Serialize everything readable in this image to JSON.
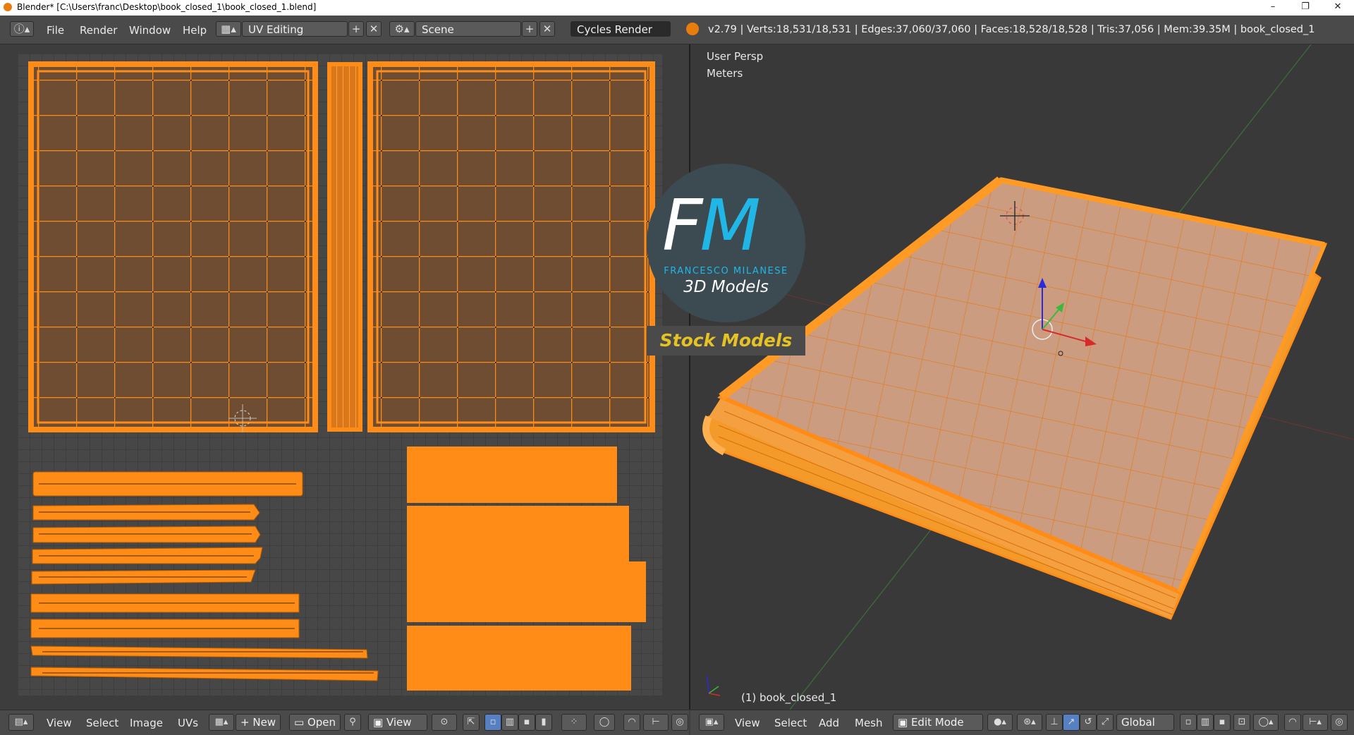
{
  "window": {
    "title": "Blender* [C:\\Users\\franc\\Desktop\\book_closed_1\\book_closed_1.blend]",
    "controls": {
      "minimize": "–",
      "maximize": "❐",
      "close": "✕"
    }
  },
  "info_header": {
    "menus": [
      "File",
      "Render",
      "Window",
      "Help"
    ],
    "screen_layout": "UV Editing",
    "scene": "Scene",
    "render_engine": "Cycles Render",
    "stats": "v2.79 | Verts:18,531/18,531 | Edges:37,060/37,060 | Faces:18,528/18,528 | Tris:37,056 | Mem:39.35M | book_closed_1"
  },
  "uv_editor": {
    "menus": [
      "View",
      "Select",
      "Image",
      "UVs"
    ],
    "new_label": "New",
    "open_label": "Open",
    "view_label": "View"
  },
  "viewport": {
    "view_label": "User Persp",
    "units_label": "Meters",
    "object_label": "(1) book_closed_1",
    "menus": [
      "View",
      "Select",
      "Add",
      "Mesh"
    ],
    "mode": "Edit Mode",
    "orientation": "Global"
  },
  "watermark": {
    "letter_f": "F",
    "letter_m": "M",
    "author": "FRANCESCO MILANESE",
    "subtitle": "3D Models",
    "banner": "Stock Models"
  },
  "colors": {
    "selection_orange": "#ff8c16",
    "uv_fill": "#6e4d33",
    "face_fill": "#cc9c80",
    "accent_blue": "#20b7e6",
    "banner_yellow": "#e6c325"
  },
  "icons": [
    "info-icon",
    "screen-icon",
    "add-icon",
    "close-icon",
    "scene-icon",
    "blender-logo-icon",
    "editor-type-icon",
    "pin-icon",
    "3d-cursor-icon",
    "axis-gizmo-icon"
  ]
}
